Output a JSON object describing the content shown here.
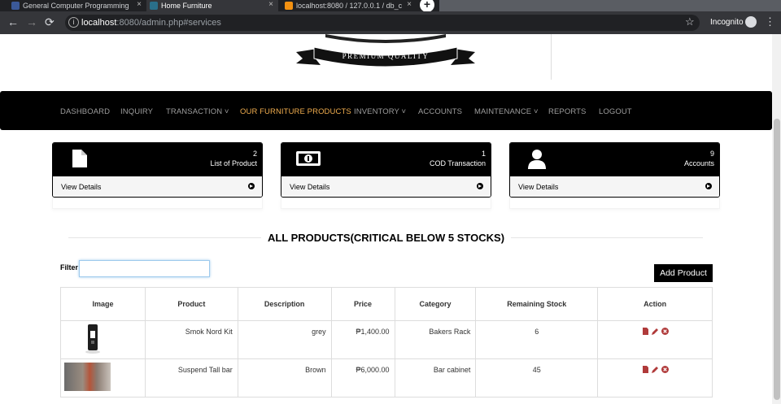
{
  "browser": {
    "tabs": [
      {
        "title": "General Computer Programming",
        "favicon": "facebook-icon"
      },
      {
        "title": "Home Furniture",
        "favicon": "page-icon",
        "active": true
      },
      {
        "title": "localhost:8080 / 127.0.0.1 / db_c",
        "favicon": "phpmyadmin-icon"
      }
    ],
    "url_host": "localhost",
    "url_rest": ":8080/admin.php#services",
    "mode_label": "Incognito"
  },
  "logo": {
    "text": "PREMIUM QUALITY"
  },
  "nav": {
    "items": [
      {
        "label": "DASHBOARD"
      },
      {
        "label": "INQUIRY"
      },
      {
        "label": "TRANSACTION ˅"
      },
      {
        "label": "OUR FURNITURE PRODUCTS",
        "active": true
      },
      {
        "label": "INVENTORY ˅"
      },
      {
        "label": "ACCOUNTS"
      },
      {
        "label": "MAINTENANCE ˅"
      },
      {
        "label": "REPORTS"
      },
      {
        "label": "LOGOUT"
      }
    ]
  },
  "panels": [
    {
      "count": "2",
      "label": "List of Product",
      "link": "View Details",
      "icon": "file-icon"
    },
    {
      "count": "1",
      "label": "COD Transaction",
      "link": "View Details",
      "icon": "money-icon"
    },
    {
      "count": "9",
      "label": "Accounts",
      "link": "View Details",
      "icon": "user-icon"
    }
  ],
  "section": {
    "title": "ALL PRODUCTS(CRITICAL BELOW 5 STOCKS)"
  },
  "filter": {
    "label": "Filter",
    "value": ""
  },
  "add_button": {
    "label": "Add Product"
  },
  "table": {
    "columns": [
      "Image",
      "Product",
      "Description",
      "Price",
      "Category",
      "Remaining Stock",
      "Action"
    ],
    "rows": [
      {
        "product": "Smok Nord Kit",
        "description": "grey",
        "price": "₱1,400.00",
        "category": "Bakers Rack",
        "stock": "6"
      },
      {
        "product": "Suspend Tall bar",
        "description": "Brown",
        "price": "₱6,000.00",
        "category": "Bar cabinet",
        "stock": "45"
      }
    ]
  },
  "colors": {
    "nav_bg": "#000000",
    "nav_active": "#f0ad4e",
    "action_icons": "#b03a3a"
  }
}
